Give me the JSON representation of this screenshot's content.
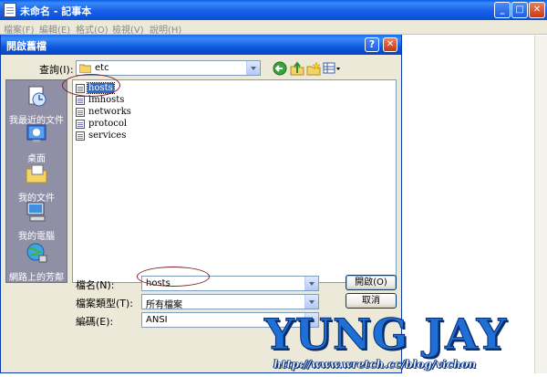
{
  "notepad": {
    "title": "未命名 - 記事本",
    "menu": [
      "檔案(F)",
      "編輯(E)",
      "格式(O)",
      "檢視(V)",
      "說明(H)"
    ],
    "min_glyph": "_",
    "max_glyph": "□",
    "close_glyph": "✕"
  },
  "dialog": {
    "title": "開啟舊檔",
    "help_glyph": "?",
    "close_glyph": "✕",
    "look_in_label": "查詢(I):",
    "look_in_value": "etc",
    "places": [
      {
        "label": "我最近的文件",
        "icon": "recent-documents-icon"
      },
      {
        "label": "桌面",
        "icon": "desktop-icon"
      },
      {
        "label": "我的文件",
        "icon": "my-documents-icon"
      },
      {
        "label": "我的電腦",
        "icon": "my-computer-icon"
      },
      {
        "label": "網路上的芳鄰",
        "icon": "network-places-icon"
      }
    ],
    "files": [
      "hosts",
      "lmhosts",
      "networks",
      "protocol",
      "services"
    ],
    "selected_file": "hosts",
    "filename_label": "檔名(N):",
    "filename_value": "hosts",
    "filetype_label": "檔案類型(T):",
    "filetype_value": "所有檔案",
    "encoding_label": "編碼(E):",
    "encoding_value": "ANSI",
    "open_button": "開啟(O)",
    "cancel_button": "取消"
  },
  "watermark": {
    "text": "YUNG JAY",
    "url": "http://www.wretch.cc/blog/vichon"
  },
  "colors": {
    "titlebar": "#0a5ee8",
    "dialog_bg": "#ece9d8",
    "selection": "#316ac5",
    "annotation": "#7a1f2b",
    "watermark": "#1e6fd6"
  }
}
